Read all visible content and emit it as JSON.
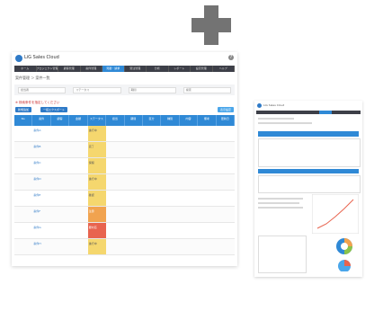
{
  "main": {
    "app_name": "LiG Sales Cloud",
    "nav": [
      "ホーム",
      "プロジェクト管理",
      "顧客管理",
      "案件管理",
      "見積・請求",
      "受注管理",
      "分析",
      "レポート",
      "設定管理",
      "ヘルプ"
    ],
    "active_nav_index": 4,
    "breadcrumb": "案件管理 ＞ 案件一覧",
    "filters": [
      "担当者",
      "ステータス",
      "期間",
      "検索"
    ],
    "hint": "※ 検索条件を指定してください",
    "buttons": {
      "add": "新規追加",
      "export": "一括エクスポート",
      "settings": "表示設定"
    },
    "columns": [
      "No",
      "案件",
      "顧客",
      "金額",
      "ステータス",
      "担当",
      "期間",
      "区分",
      "種別",
      "内容",
      "備考",
      "更新日"
    ],
    "rows": [
      {
        "name": "案件A",
        "status": "進行中",
        "level": "normal"
      },
      {
        "name": "案件B",
        "status": "完了",
        "level": "normal"
      },
      {
        "name": "案件C",
        "status": "保留",
        "level": "normal"
      },
      {
        "name": "案件D",
        "status": "進行中",
        "level": "normal"
      },
      {
        "name": "案件E",
        "status": "確認",
        "level": "normal"
      },
      {
        "name": "案件F",
        "status": "注意",
        "level": "warn"
      },
      {
        "name": "案件G",
        "status": "要対応",
        "level": "hot"
      },
      {
        "name": "案件H",
        "status": "進行中",
        "level": "normal"
      }
    ]
  },
  "thumb": {
    "title": "LiG Sales Cloud"
  },
  "colors": {
    "accent": "#2f89d6",
    "nav": "#3d3f48",
    "plus": "#737373"
  }
}
